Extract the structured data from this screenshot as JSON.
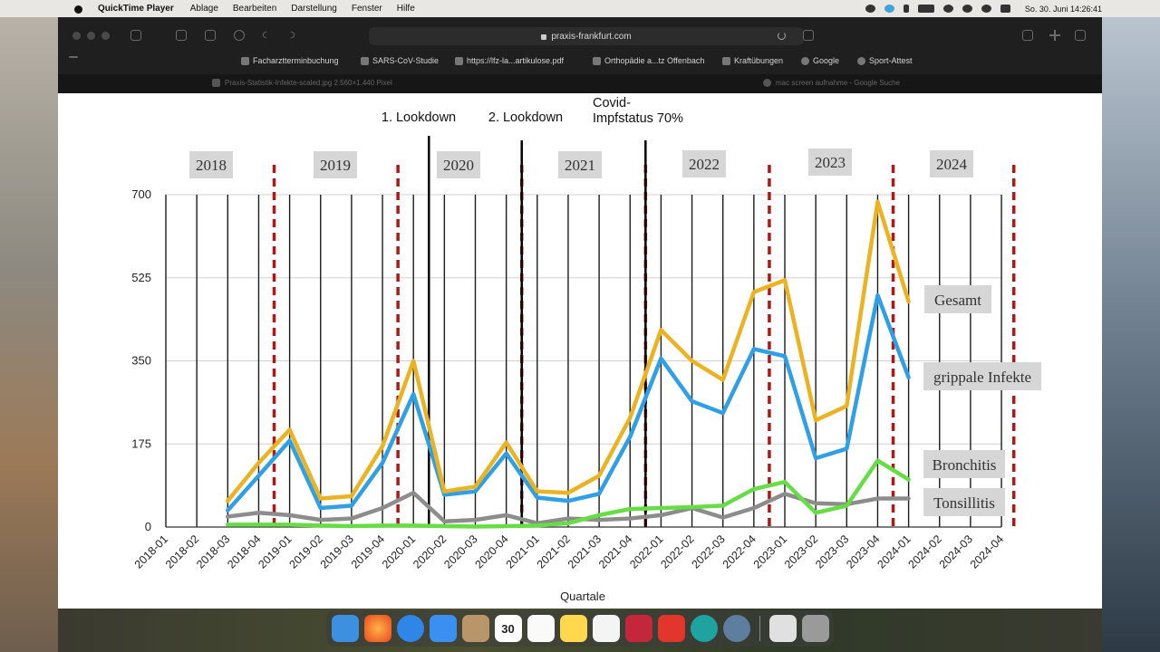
{
  "menubar": {
    "app_name": "QuickTime Player",
    "menus": [
      "Ablage",
      "Bearbeiten",
      "Darstellung",
      "Fenster",
      "Hilfe"
    ],
    "clock": "So. 30. Juni  14:26:41"
  },
  "browser": {
    "url": "praxis-frankfurt.com",
    "bookmarks": [
      "Facharztterminbuchung",
      "SARS-CoV-Studie",
      "https://lfz-la...artikulose.pdf",
      "Orthopädie a...tz Offenbach",
      "Kraftübungen",
      "Google",
      "Sport-Attest"
    ],
    "tabs": [
      "Praxis-Statistik-Infekte-scaled.jpg 2.560×1.440 Pixel",
      "mac screen aufnahme - Google Suche"
    ]
  },
  "dock": {
    "apps": [
      "finder-icon",
      "firefox-icon",
      "safari-icon",
      "mail-icon",
      "contacts-icon",
      "calendar-icon",
      "reminders-icon",
      "notes-icon",
      "textedit-icon",
      "todo-icon",
      "anydesk-icon",
      "eset-icon",
      "quicktime-icon",
      "preview-icon",
      "trash-icon"
    ],
    "calendar_day": "30"
  },
  "chart_data": {
    "type": "line",
    "xlabel": "Quartale",
    "ylabel": "",
    "ylim": [
      0,
      700
    ],
    "yticks": [
      0,
      175,
      350,
      525,
      700
    ],
    "x": [
      "2018-01",
      "2018-02",
      "2018-03",
      "2018-04",
      "2019-01",
      "2019-02",
      "2019-03",
      "2019-04",
      "2020-01",
      "2020-02",
      "2020-03",
      "2020-04",
      "2021-01",
      "2021-02",
      "2021-03",
      "2021-04",
      "2022-01",
      "2022-02",
      "2022-03",
      "2022-04",
      "2023-01",
      "2023-02",
      "2023-03",
      "2023-04",
      "2024-01",
      "2024-02",
      "2024-03",
      "2024-04"
    ],
    "series": [
      {
        "name": "Gesamt",
        "color": "#ebb321",
        "values": [
          null,
          null,
          55,
          135,
          205,
          60,
          65,
          170,
          350,
          75,
          85,
          178,
          75,
          72,
          108,
          230,
          415,
          350,
          310,
          495,
          520,
          225,
          255,
          685,
          475,
          null,
          null,
          null
        ]
      },
      {
        "name": "grippale Infekte",
        "color": "#2f9fe6",
        "values": [
          null,
          null,
          35,
          108,
          182,
          40,
          45,
          135,
          280,
          68,
          75,
          155,
          62,
          55,
          70,
          190,
          355,
          265,
          240,
          375,
          360,
          145,
          165,
          488,
          315,
          null,
          null,
          null
        ]
      },
      {
        "name": "Bronchitis",
        "color": "#66dd44",
        "values": [
          null,
          null,
          5,
          5,
          5,
          3,
          2,
          3,
          3,
          2,
          1,
          2,
          3,
          8,
          25,
          38,
          40,
          42,
          45,
          80,
          95,
          30,
          45,
          140,
          100,
          null,
          null,
          null
        ]
      },
      {
        "name": "Tonsillitis",
        "color": "#8c8c8c",
        "values": [
          null,
          null,
          22,
          30,
          25,
          15,
          18,
          40,
          72,
          12,
          15,
          25,
          8,
          18,
          15,
          18,
          25,
          40,
          20,
          40,
          70,
          50,
          48,
          60,
          60,
          null,
          null,
          null
        ]
      }
    ],
    "year_labels": [
      "2018",
      "2019",
      "2020",
      "2021",
      "2022",
      "2023",
      "2024"
    ],
    "year_boundaries": [
      "2018-04/2019-01",
      "2019-04/2020-01",
      "2020-04/2021-01",
      "2021-04/2022-01",
      "2022-04/2023-01",
      "2023-04/2024-01",
      "after 2024-04"
    ],
    "event_lines": [
      {
        "label": "1. Lookdown",
        "between": [
          "2020-01",
          "2020-02"
        ]
      },
      {
        "label": "2. Lookdown",
        "between": [
          "2020-04",
          "2021-01"
        ]
      },
      {
        "label": "Covid-\nImpfstatus 70%",
        "between": [
          "2021-04",
          "2022-01"
        ]
      }
    ],
    "legend_placement": "right, inline labels",
    "grid": true
  }
}
